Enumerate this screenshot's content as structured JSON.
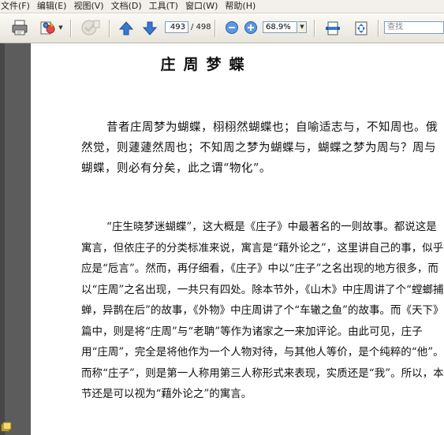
{
  "menu": {
    "items": [
      "文件(F)",
      "编辑(E)",
      "视图(V)",
      "文档(D)",
      "工具(T)",
      "窗口(W)",
      "帮助(H)"
    ]
  },
  "toolbar": {
    "page_current": "493",
    "page_total": "/ 498",
    "zoom_value": "68.9%",
    "search_placeholder": "查找"
  },
  "icons": {
    "print": "printer-icon",
    "sign": "sign-icon",
    "gray": "disabled-tool-icon",
    "prev": "arrow-up-icon",
    "next": "arrow-down-icon",
    "zoom_out": "zoom-out-icon",
    "zoom_in": "zoom-in-icon",
    "fit_width": "fit-width-icon",
    "fit_page": "fit-page-icon",
    "bookmarks": "bookmarks-icon"
  },
  "colors": {
    "toolbar_blue": "#3a6fc4",
    "left_pane": "#5c5c5c"
  },
  "document": {
    "title": "庄周梦蝶",
    "paragraph1": "昔者庄周梦为蝴蝶，栩栩然蝴蝶也；自喻适志与，不知周也。俄然觉，则蘧蘧然周也；不知周之梦为蝴蝶与，蝴蝶之梦为周与？周与蝴蝶，则必有分矣，此之谓“物化”。",
    "paragraph2": "“庄生晓梦迷蝴蝶”，这大概是《庄子》中最著名的一则故事。都说这是寓言，但依庄子的分类标准来说，寓言是“藉外论之”，这里讲自己的事，似乎应是“卮言”。然而，再仔细看，《庄子》中以“庄子”之名出现的地方很多，而以“庄周”之名出现，一共只有四处。除本节外，《山木》中庄周讲了个“螳螂捕蝉，异鹊在后”的故事，《外物》中庄周讲了个“车辙之鱼”的故事。而《天下》篇中，则是将“庄周”与“老聃”等作为诸家之一来加评论。由此可见，庄子用“庄周”，完全是将他作为一个人物对待，与其他人等价，是个纯粹的“他”。而称“庄子”，则是第一人称用第三人称形式来表现，实质还是“我”。所以，本节还是可以视为“藉外论之”的寓言。"
  }
}
